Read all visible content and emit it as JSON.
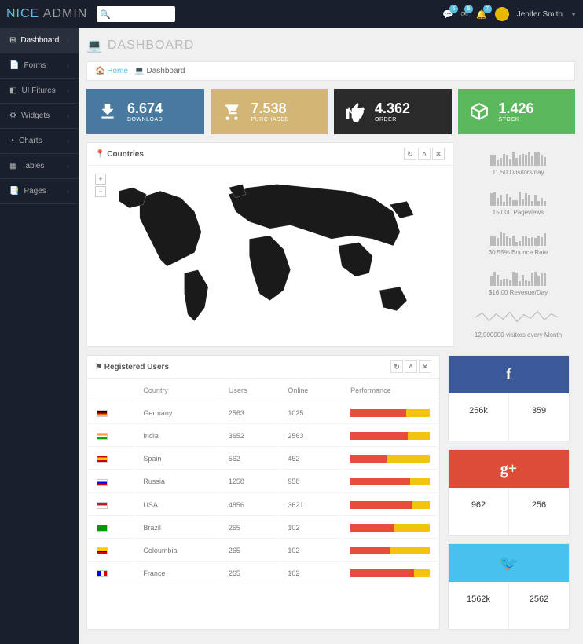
{
  "brand": {
    "part1": "NICE",
    "part2": "ADMIN"
  },
  "search": {
    "placeholder": ""
  },
  "topbar": {
    "badges": [
      "6",
      "5",
      "7"
    ],
    "user": "Jenifer Smith"
  },
  "sidebar": {
    "items": [
      {
        "label": "Dashboard",
        "active": true
      },
      {
        "label": "Forms"
      },
      {
        "label": "UI Fitures"
      },
      {
        "label": "Widgets"
      },
      {
        "label": "Charts"
      },
      {
        "label": "Tables"
      },
      {
        "label": "Pages"
      }
    ]
  },
  "page": {
    "title": "DASHBOARD"
  },
  "breadcrumb": {
    "home": "Home",
    "current": "Dashboard"
  },
  "stats": [
    {
      "value": "6.674",
      "label": "DOWNLOAD",
      "color": "c-blue"
    },
    {
      "value": "7.538",
      "label": "PURCHASED",
      "color": "c-tan"
    },
    {
      "value": "4.362",
      "label": "ORDER",
      "color": "c-dark"
    },
    {
      "value": "1.426",
      "label": "STOCK",
      "color": "c-green"
    }
  ],
  "map": {
    "title": "Countries"
  },
  "ministats": [
    {
      "text": "11,500 visitors/day"
    },
    {
      "text": "15,000 Pageviews"
    },
    {
      "text": "30.55% Bounce Rate"
    },
    {
      "text": "$16,00 Revenue/Day"
    },
    {
      "text": "12,000000 visitors every Month"
    }
  ],
  "users_panel": {
    "title": "Registered Users"
  },
  "users_table": {
    "headers": [
      "",
      "Country",
      "Users",
      "Online",
      "Performance"
    ],
    "rows": [
      {
        "flag": "de",
        "country": "Germany",
        "users": "2563",
        "online": "1025",
        "perf": 70
      },
      {
        "flag": "in",
        "country": "India",
        "users": "3652",
        "online": "2563",
        "perf": 72
      },
      {
        "flag": "es",
        "country": "Spain",
        "users": "562",
        "online": "452",
        "perf": 45
      },
      {
        "flag": "ru",
        "country": "Russia",
        "users": "1258",
        "online": "958",
        "perf": 75
      },
      {
        "flag": "us",
        "country": "USA",
        "users": "4856",
        "online": "3621",
        "perf": 78
      },
      {
        "flag": "br",
        "country": "Brazil",
        "users": "265",
        "online": "102",
        "perf": 55
      },
      {
        "flag": "co",
        "country": "Coloumbia",
        "users": "265",
        "online": "102",
        "perf": 50
      },
      {
        "flag": "fr",
        "country": "France",
        "users": "265",
        "online": "102",
        "perf": 80
      }
    ]
  },
  "social": [
    {
      "net": "facebook",
      "bg": "fb-bg",
      "left_num": "256k",
      "left_sub": "",
      "right_num": "359",
      "right_sub": ""
    },
    {
      "net": "google-plus",
      "bg": "gp-bg",
      "left_num": "962",
      "left_sub": "",
      "right_num": "256",
      "right_sub": ""
    },
    {
      "net": "twitter",
      "bg": "tw-bg",
      "left_num": "1562k",
      "left_sub": "",
      "right_num": "2562",
      "right_sub": ""
    }
  ],
  "chart_data": {
    "type": "table",
    "note": "Admin dashboard stat tiles and user table; chart sparklines are decorative with no readable axis values."
  }
}
